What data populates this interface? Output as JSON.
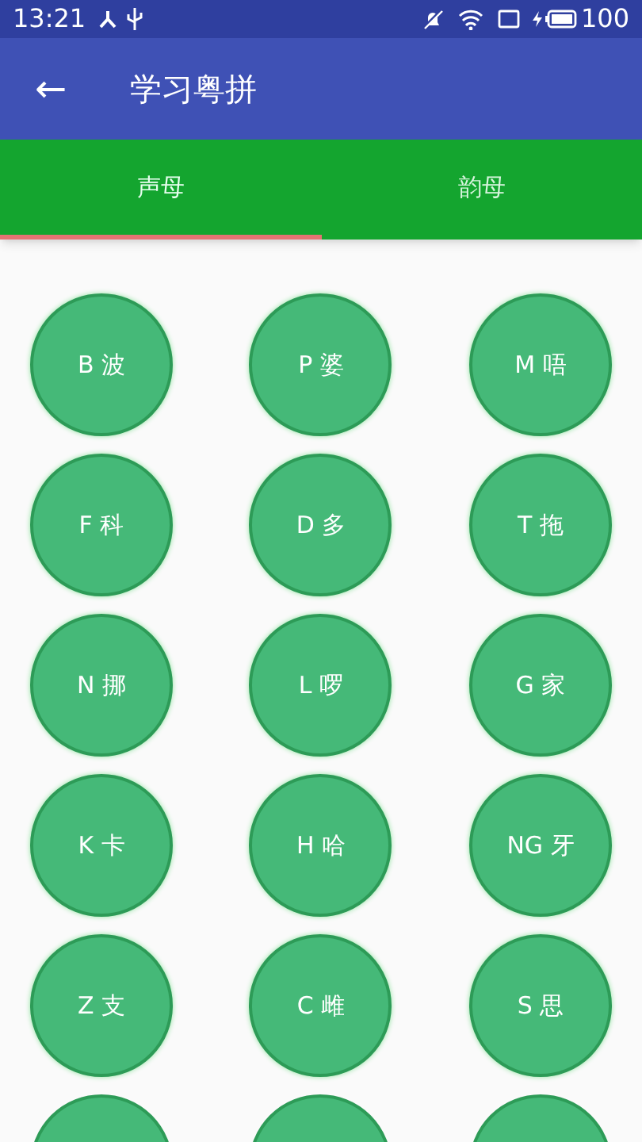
{
  "status_bar": {
    "time": "13:21",
    "battery": "100"
  },
  "app_bar": {
    "back": "←",
    "title": "学习粤拼"
  },
  "tabs": [
    {
      "label": "声母",
      "selected": true
    },
    {
      "label": "韵母",
      "selected": false
    }
  ],
  "keys": [
    {
      "label": "B 波"
    },
    {
      "label": "P 婆"
    },
    {
      "label": "M 唔"
    },
    {
      "label": "F 科"
    },
    {
      "label": "D 多"
    },
    {
      "label": "T 拖"
    },
    {
      "label": "N 挪"
    },
    {
      "label": "L 啰"
    },
    {
      "label": "G 家"
    },
    {
      "label": "K 卡"
    },
    {
      "label": "H 哈"
    },
    {
      "label": "NG 牙"
    },
    {
      "label": "Z 支"
    },
    {
      "label": "C 雌"
    },
    {
      "label": "S 思"
    }
  ]
}
